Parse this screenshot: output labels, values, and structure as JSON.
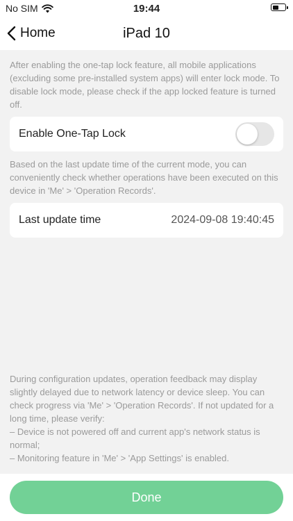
{
  "status_bar": {
    "carrier": "No SIM",
    "time": "19:44",
    "battery_level": 0.55
  },
  "nav": {
    "back_label": "Home",
    "title": "iPad 10"
  },
  "lock_description": "After enabling the one-tap lock feature, all mobile applications (excluding some pre-installed system apps) will enter lock mode. To disable lock mode, please check if the app locked feature is turned off.",
  "one_tap_lock": {
    "label": "Enable One-Tap Lock",
    "enabled": false
  },
  "update_description": "Based on the last update time of the current mode, you can conveniently check whether operations have been executed on this device in 'Me' > 'Operation Records'.",
  "last_update": {
    "label": "Last update time",
    "value": "2024-09-08 19:40:45"
  },
  "feedback_note": {
    "intro": "During configuration updates, operation feedback may display slightly delayed due to network latency or device sleep. You can check progress via 'Me' > 'Operation Records'. If not updated for a long time, please verify:",
    "items": [
      "– Device is not powered off and current app's network status is normal;",
      "– Monitoring feature in 'Me' > 'App Settings' is enabled."
    ]
  },
  "done_label": "Done",
  "colors": {
    "accent": "#72d196",
    "background": "#f2f2f2",
    "secondary_text": "#9a9a9a"
  }
}
